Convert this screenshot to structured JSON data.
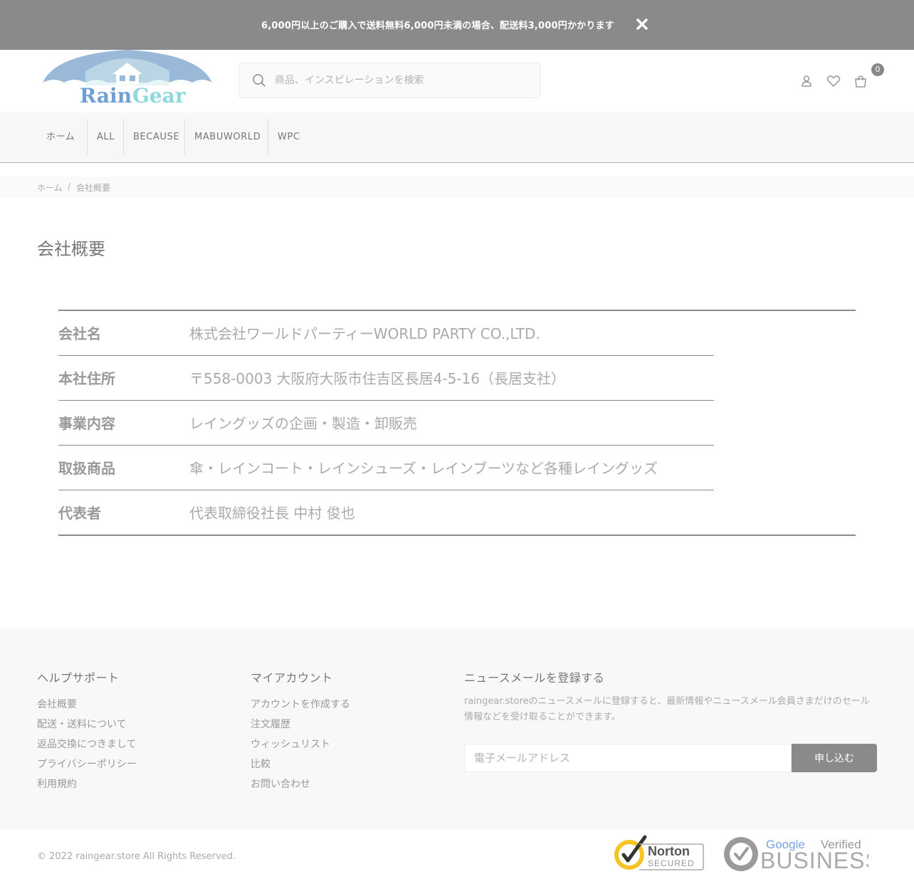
{
  "announcement": {
    "text": "6,000円以上のご購入で送料無料6,000円未満の場合、配送料3,000円かかります"
  },
  "logo": {
    "word1": "Rain",
    "word2": "Gear"
  },
  "search": {
    "placeholder": "商品、インスピレーションを検索"
  },
  "header": {
    "cart_count": "0"
  },
  "nav": {
    "items": [
      "ホーム",
      "ALL",
      "BECAUSE",
      "MABUWORLD",
      "WPC"
    ]
  },
  "breadcrumb": {
    "home": "ホーム",
    "separator": "/",
    "current": "会社概要"
  },
  "page": {
    "title": "会社概要"
  },
  "company": {
    "rows": [
      {
        "label": "会社名",
        "value": "株式会社ワールドパーティーWORLD PARTY CO.,LTD."
      },
      {
        "label": "本社住所",
        "value": "〒558-0003 大阪府大阪市住吉区長居4-5-16（長居支社）"
      },
      {
        "label": "事業内容",
        "value": "レイングッズの企画・製造・卸販売"
      },
      {
        "label": "取扱商品",
        "value": "傘・レインコート・レインシューズ・レインブーツなど各種レイングッズ"
      },
      {
        "label": "代表者",
        "value": "代表取締役社長 中村 俊也"
      }
    ]
  },
  "footer": {
    "help": {
      "title": "ヘルプサポート",
      "links": [
        "会社概要",
        "配送・送料について",
        "返品交換につきまして",
        "プライバシーポリシー",
        "利用規約"
      ]
    },
    "account": {
      "title": "マイアカウント",
      "links": [
        "アカウントを作成する",
        "注文履歴",
        "ウィッシュリスト",
        "比較",
        "お問い合わせ"
      ]
    },
    "newsletter": {
      "title": "ニュースメールを登録する",
      "description": "raingear.storeのニュースメールに登録すると、最新情報やニュースメール会員さまだけのセール情報などを受け取ることができます。",
      "placeholder": "電子メールアドレス",
      "button": "申し込む"
    },
    "copyright": "© 2022 raingear.store All Rights Reserved.",
    "badges": {
      "norton_title": "Norton",
      "norton_sub": "SECURED",
      "google": "Google",
      "verified": "Verified",
      "business": "BUSINESS"
    }
  },
  "colors": {
    "announcement_bg": "#8a8a8a",
    "logo_umbrella": "#9ab8d8",
    "logo_rain": "#6f9ed4",
    "logo_gear": "#8ed8de",
    "norton_yellow": "#f7c325"
  }
}
